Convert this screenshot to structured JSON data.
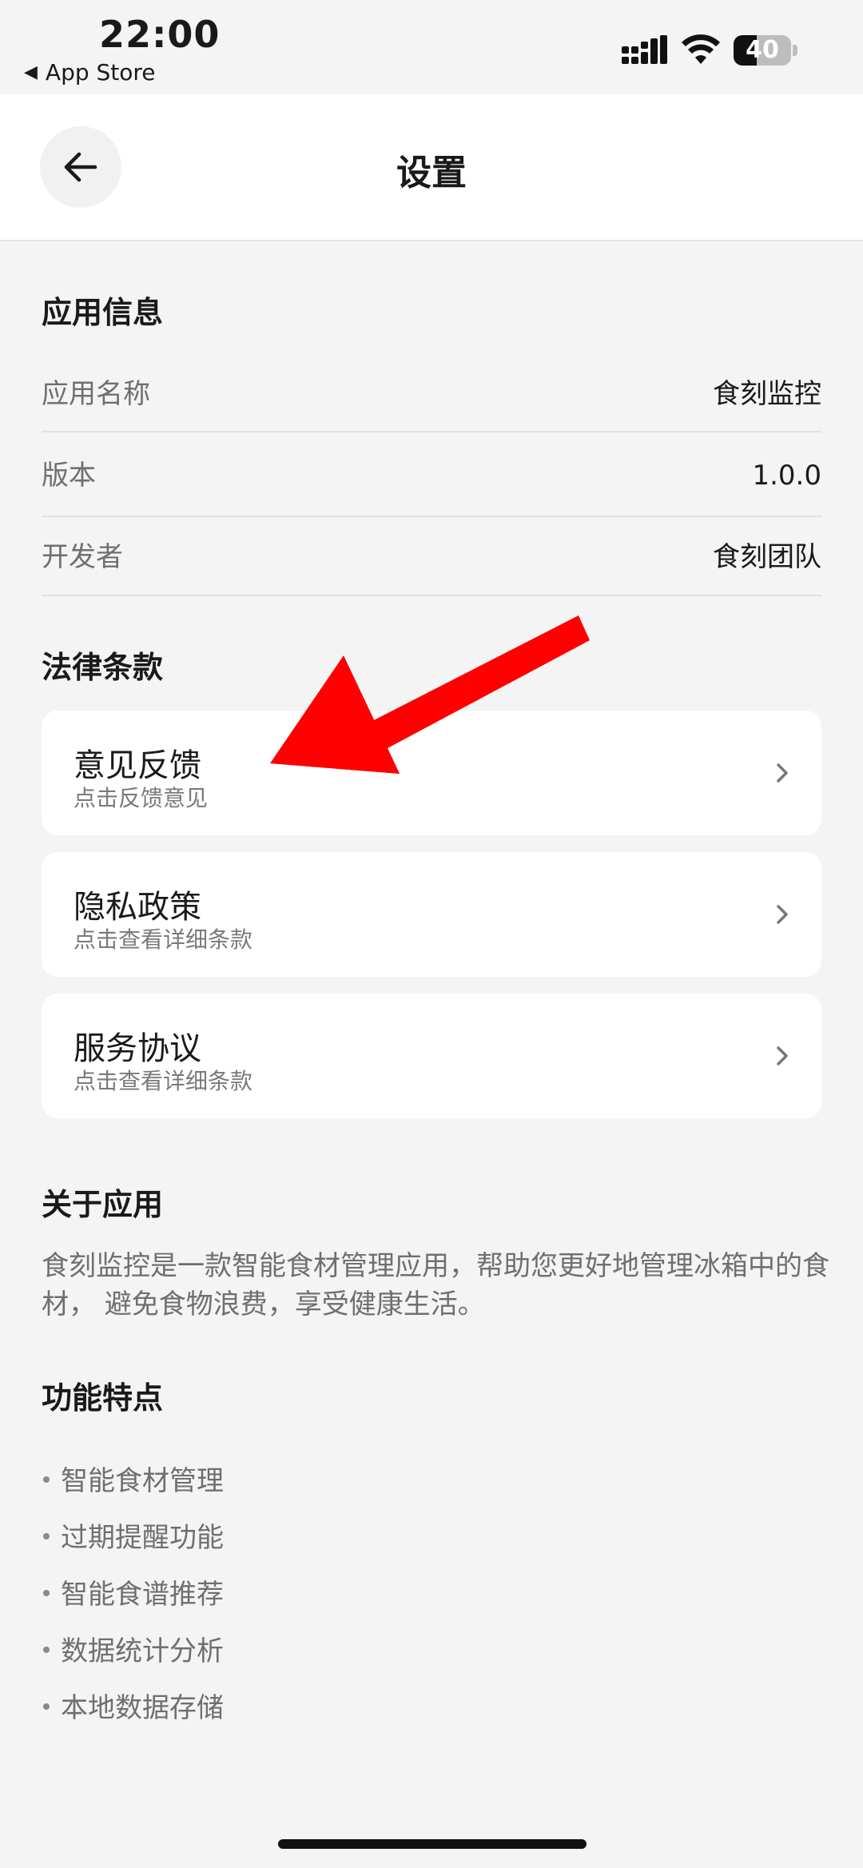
{
  "status_bar": {
    "time": "22:00",
    "back_app_label": "App Store",
    "battery_level": "40"
  },
  "header": {
    "title": "设置"
  },
  "app_info": {
    "section_title": "应用信息",
    "rows": [
      {
        "label": "应用名称",
        "value": "食刻监控"
      },
      {
        "label": "版本",
        "value": "1.0.0"
      },
      {
        "label": "开发者",
        "value": "食刻团队"
      }
    ]
  },
  "legal": {
    "section_title": "法律条款",
    "items": [
      {
        "title": "意见反馈",
        "subtitle": "点击反馈意见"
      },
      {
        "title": "隐私政策",
        "subtitle": "点击查看详细条款"
      },
      {
        "title": "服务协议",
        "subtitle": "点击查看详细条款"
      }
    ]
  },
  "about": {
    "section_title": "关于应用",
    "text": "食刻监控是一款智能食材管理应用，帮助您更好地管理冰箱中的食材， 避免食物浪费，享受健康生活。"
  },
  "features": {
    "section_title": "功能特点",
    "items": [
      "智能食材管理",
      "过期提醒功能",
      "智能食谱推荐",
      "数据统计分析",
      "本地数据存储"
    ]
  },
  "colors": {
    "background": "#f4f4f4",
    "card": "#ffffff",
    "annotation_arrow": "#ff0000"
  }
}
